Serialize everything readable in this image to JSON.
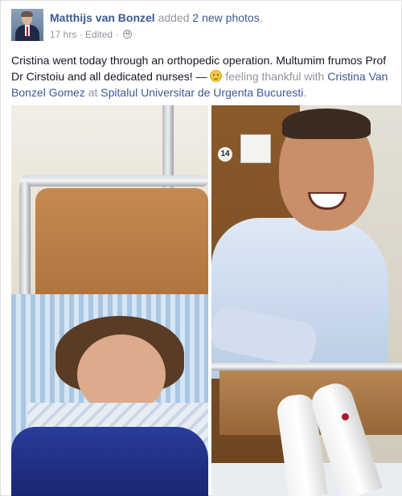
{
  "post": {
    "author": "Matthijs van Bonzel",
    "action_prefix": "added",
    "action_link": "2 new photos",
    "action_suffix": ".",
    "timestamp": "17 hrs",
    "separator1": "·",
    "edited": "Edited",
    "separator2": "·",
    "privacy_icon": "globe-icon"
  },
  "body": {
    "line1": "Cristina went today through an orthopedic operation. Multumim frumos Prof Dr Cirstoiu and all dedicated nurses! —",
    "feeling": "feeling thankful",
    "with_word": "with",
    "tagged_person": "Cristina Van Bonzel Gomez",
    "at_word": "at",
    "place": "Spitalul Universitar de Urgenta Bucuresti",
    "end": "."
  },
  "photos": {
    "left": "photo-patient-in-bed",
    "right": "photo-doctor-smiling",
    "room_number": "14"
  }
}
